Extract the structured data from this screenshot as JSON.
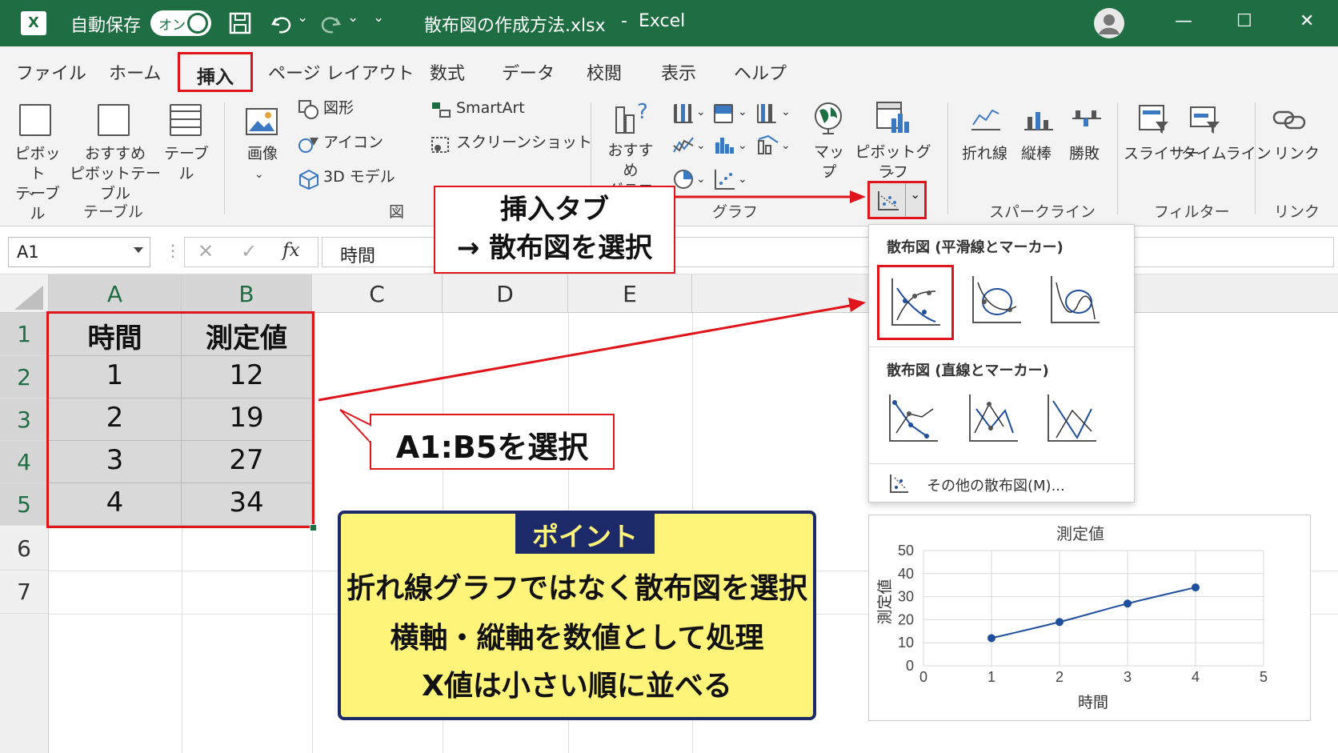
{
  "titlebar": {
    "app_icon": "X",
    "autosave_label": "自動保存",
    "autosave_state": "オン",
    "filename": "散布図の作成方法.xlsx",
    "separator": "-",
    "app_name": "Excel",
    "minimize": "—",
    "maximize": "☐",
    "close": "✕",
    "undo_caret": "⌄",
    "redo_caret": "⌄",
    "qat_caret": "⌄"
  },
  "tabs": [
    "ファイル",
    "ホーム",
    "挿入",
    "ページ レイアウト",
    "数式",
    "データ",
    "校閲",
    "表示",
    "ヘルプ"
  ],
  "ribbon": {
    "pivot_line1": "ピボット",
    "pivot_line2": "テーブル",
    "rec_pivot_line1": "おすすめ",
    "rec_pivot_line2": "ピボットテーブル",
    "table": "テーブル",
    "group_table": "テーブル",
    "image": "画像",
    "shapes": "図形",
    "icons": "アイコン",
    "models3d": "3D モデル",
    "smartart": "SmartArt",
    "screenshot": "スクリーンショット",
    "group_figure": "図",
    "rec_chart_line1": "おすすめ",
    "rec_chart_line2": "グラフ",
    "map": "マップ",
    "pivot_chart": "ピボットグラフ",
    "group_chart": "グラフ",
    "spark_line": "折れ線",
    "spark_column": "縦棒",
    "spark_winloss": "勝敗",
    "group_sparkline": "スパークライン",
    "slicer": "スライサー",
    "timeline": "タイムライン",
    "group_filter": "フィルター",
    "link": "リンク",
    "group_link": "リンク",
    "caret": "⌄"
  },
  "formula_bar": {
    "name_box": "A1",
    "cancel": "✕",
    "enter": "✓",
    "fx": "fx",
    "content": "時間"
  },
  "columns": [
    "A",
    "B",
    "C",
    "D",
    "E"
  ],
  "rows": [
    "1",
    "2",
    "3",
    "4",
    "5",
    "6",
    "7"
  ],
  "cells": [
    [
      "時間",
      "測定値"
    ],
    [
      "1",
      "12"
    ],
    [
      "2",
      "19"
    ],
    [
      "3",
      "27"
    ],
    [
      "4",
      "34"
    ]
  ],
  "callouts": {
    "insert_line1": "挿入タブ",
    "insert_line2": "→ 散布図を選択",
    "select_range": "A1:B5を選択"
  },
  "dropdown": {
    "header_smooth": "散布図 (平滑線とマーカー)",
    "header_straight": "散布図 (直線とマーカー)",
    "more_scatter": "その他の散布図(M)..."
  },
  "point_box": {
    "badge": "ポイント",
    "line1": "折れ線グラフではなく散布図を選択",
    "line2": "横軸・縦軸を数値として処理",
    "line3": "X値は小さい順に並べる"
  },
  "colors": {
    "excel_green": "#1f6e43",
    "highlight_red": "#e0151b",
    "point_yellow": "#fff47a",
    "point_navy": "#1c2a6a",
    "series_blue": "#1f4e9c"
  },
  "chart_data": {
    "type": "scatter",
    "title": "測定値",
    "xlabel": "時間",
    "ylabel": "測定値",
    "x": [
      1,
      2,
      3,
      4
    ],
    "y": [
      12,
      19,
      27,
      34
    ],
    "xlim": [
      0,
      5
    ],
    "ylim": [
      0,
      50
    ],
    "xticks": [
      "0",
      "1",
      "2",
      "3",
      "4",
      "5"
    ],
    "yticks": [
      "0",
      "10",
      "20",
      "30",
      "40",
      "50"
    ],
    "smooth": true,
    "grid": true
  }
}
